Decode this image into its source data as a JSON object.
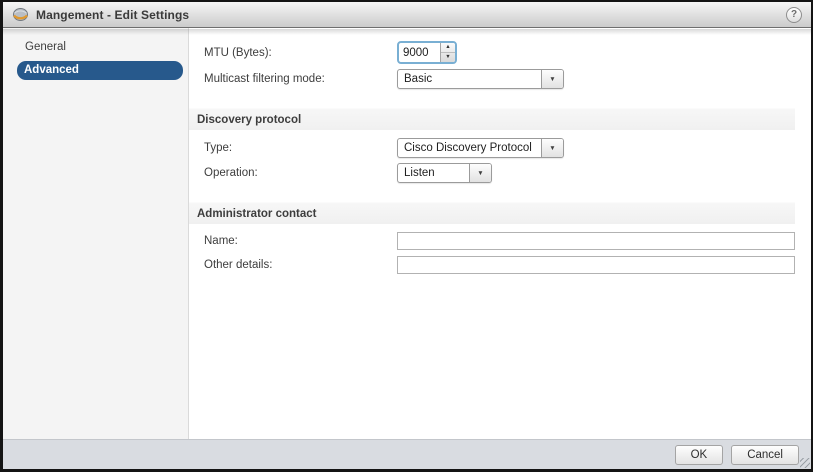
{
  "window": {
    "title": "Mangement - Edit Settings",
    "help_glyph": "?"
  },
  "sidebar": {
    "items": [
      {
        "label": "General",
        "selected": false
      },
      {
        "label": "Advanced",
        "selected": true
      }
    ]
  },
  "content": {
    "mtu_label": "MTU (Bytes):",
    "mtu_value": "9000",
    "multicast_label": "Multicast filtering mode:",
    "multicast_value": "Basic",
    "discovery_section_title": "Discovery protocol",
    "type_label": "Type:",
    "type_value": "Cisco Discovery Protocol",
    "operation_label": "Operation:",
    "operation_value": "Listen",
    "admin_section_title": "Administrator contact",
    "name_label": "Name:",
    "name_value": "",
    "other_details_label": "Other details:",
    "other_details_value": ""
  },
  "footer": {
    "ok_label": "OK",
    "cancel_label": "Cancel"
  },
  "icons": {
    "spin_up": "▲",
    "spin_down": "▼",
    "dropdown_arrow": "▼"
  },
  "colors": {
    "selected-nav-bg": "#27598C",
    "focus-ring": "#79afd3",
    "footer-bg": "#d9dce1",
    "titlebar-text": "#3a3a3a"
  }
}
